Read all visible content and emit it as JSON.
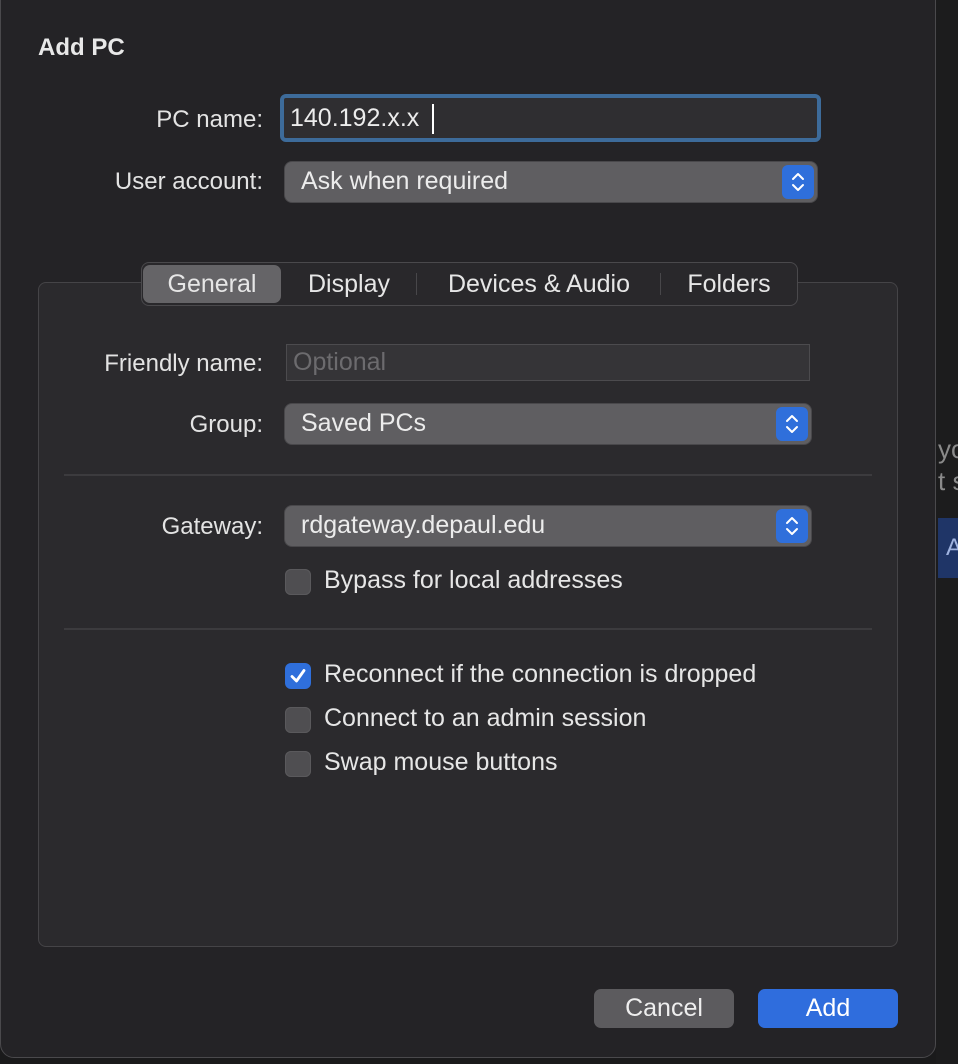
{
  "dialog": {
    "title": "Add PC",
    "pc_name": {
      "label": "PC name:",
      "value": "140.192.x.x"
    },
    "user_account": {
      "label": "User account:",
      "value": "Ask when required"
    },
    "tabs": [
      {
        "label": "General",
        "active": true
      },
      {
        "label": "Display",
        "active": false
      },
      {
        "label": "Devices & Audio",
        "active": false
      },
      {
        "label": "Folders",
        "active": false
      }
    ],
    "general": {
      "friendly_name": {
        "label": "Friendly name:",
        "value": "",
        "placeholder": "Optional"
      },
      "group": {
        "label": "Group:",
        "value": "Saved PCs"
      },
      "gateway": {
        "label": "Gateway:",
        "value": "rdgateway.depaul.edu"
      },
      "bypass_local": {
        "label": "Bypass for local addresses",
        "checked": false
      },
      "reconnect": {
        "label": "Reconnect if the connection is dropped",
        "checked": true
      },
      "admin_session": {
        "label": "Connect to an admin session",
        "checked": false
      },
      "swap_mouse": {
        "label": "Swap mouse buttons",
        "checked": false
      }
    },
    "buttons": {
      "cancel": "Cancel",
      "add": "Add"
    }
  },
  "background_app": {
    "partial_text_1": "yo",
    "partial_text_2": "t s",
    "partial_button": "A"
  },
  "colors": {
    "accent": "#2f6fdb",
    "focus_ring": "#3d6b9a",
    "sheet_bg": "#242326"
  }
}
